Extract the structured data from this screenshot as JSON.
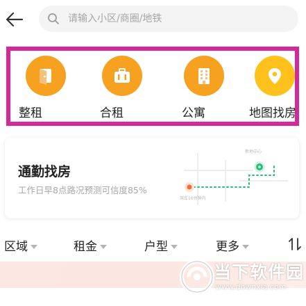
{
  "search": {
    "placeholder": "请输入小区/商圈/地铁"
  },
  "categories": [
    {
      "label": "整租",
      "icon": "door-icon"
    },
    {
      "label": "合租",
      "icon": "suitcase-icon"
    },
    {
      "label": "公寓",
      "icon": "building-icon"
    },
    {
      "label": "地图找房",
      "icon": "map-pin-icon"
    }
  ],
  "commute": {
    "title": "通勤找房",
    "subtitle": "工作日早8点路况预测可信度85%",
    "map_labels": {
      "top": "新地中心",
      "bottom": "驾车10分钟内"
    }
  },
  "filters": [
    {
      "label": "区域"
    },
    {
      "label": "租金"
    },
    {
      "label": "户型"
    },
    {
      "label": "更多"
    }
  ],
  "watermark": {
    "title": "当下软件园",
    "url": "www.downxia.com"
  },
  "colors": {
    "highlight_border": "#d5289a",
    "icon_orange": "#f6a120",
    "icon_yellow": "#ffc21d",
    "commute_green": "#22c07a",
    "commute_orange": "#f06d3a"
  }
}
